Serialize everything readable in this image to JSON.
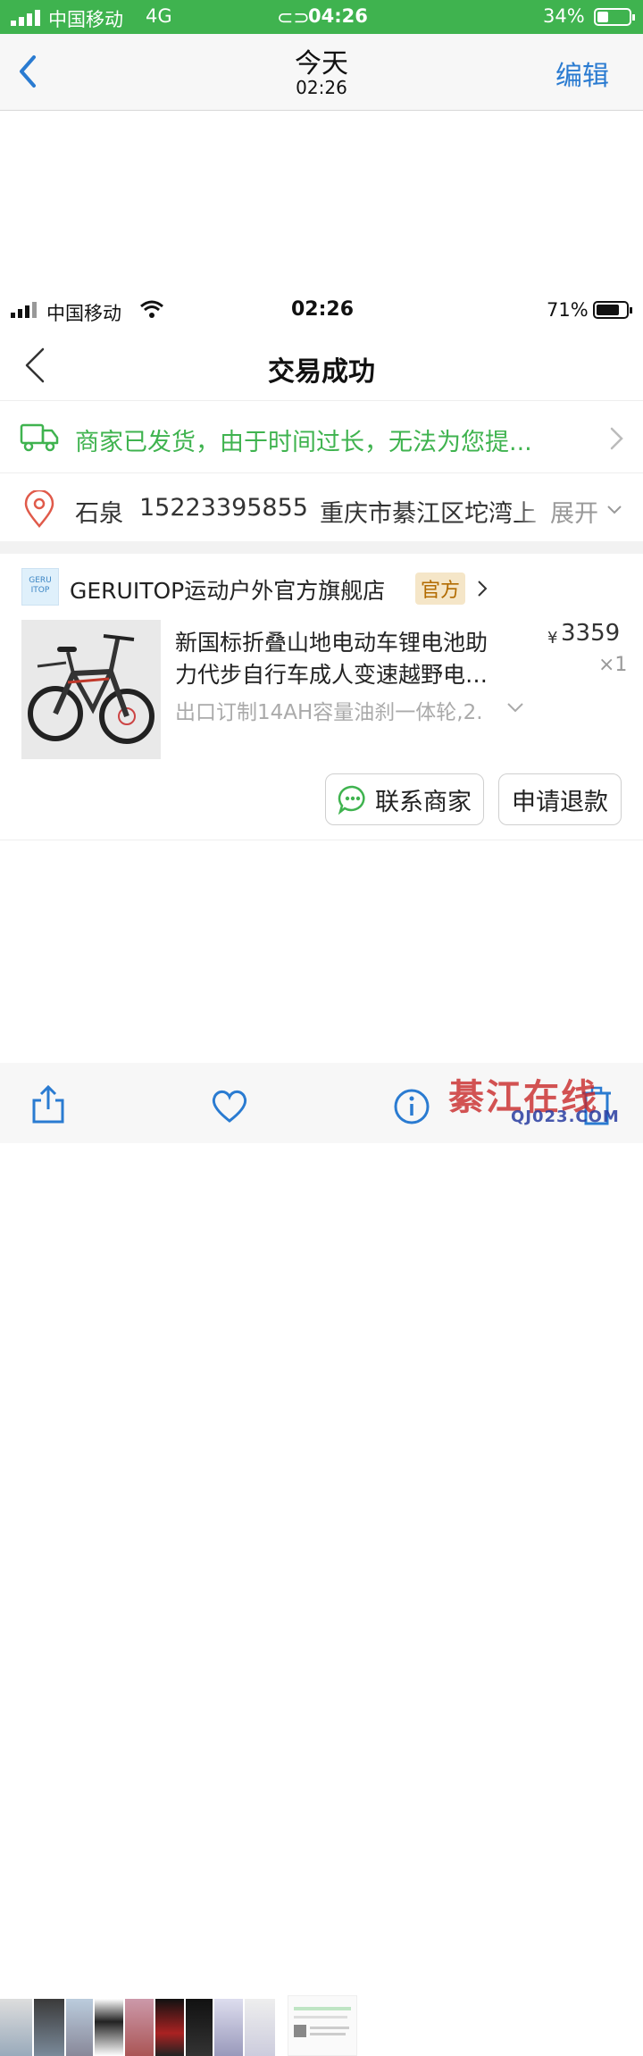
{
  "outer_status": {
    "carrier": "中国移动",
    "network": "4G",
    "time": "04:26",
    "battery": "34%"
  },
  "outer_nav": {
    "title": "今天",
    "subtitle": "02:26",
    "edit_label": "编辑"
  },
  "inner_status": {
    "carrier": "中国移动",
    "time": "02:26",
    "battery": "71%"
  },
  "inner_nav": {
    "title": "交易成功"
  },
  "shipping": {
    "text": "商家已发货，由于时间过长，无法为您提..."
  },
  "address": {
    "name": "石泉",
    "phone": "15223395855",
    "addr": "重庆市綦江区坨湾上",
    "expand": "展开"
  },
  "shop": {
    "logo_text_1": "GERU",
    "logo_text_2": "ITOP",
    "name": "GERUITOP运动户外官方旗舰店",
    "badge": "官方"
  },
  "product": {
    "title_line1": "新国标折叠山地电动车锂电池助",
    "title_line2": "力代步自行车成人变速越野电…",
    "price_symbol": "¥",
    "price": "3359",
    "quantity": "×1",
    "spec": "出口订制14AH容量油刹一体轮,2."
  },
  "actions": {
    "contact_label": "联系商家",
    "refund_label": "申请退款"
  },
  "watermark": {
    "text": "綦江在线",
    "url": "QJ023.COM"
  },
  "colors": {
    "status_green": "#3fb34f",
    "shipping_green": "#3fb34f",
    "ios_blue": "#2a7bd1",
    "badge_bg": "#f5e6c8",
    "badge_text": "#b26b00"
  }
}
